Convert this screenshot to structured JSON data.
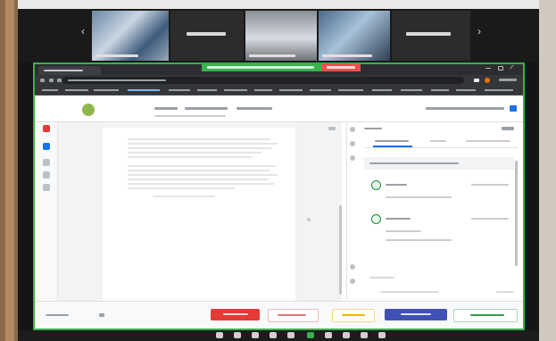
{
  "meeting": {
    "strip_nav_left": "‹",
    "strip_nav_right": "›",
    "participants": [
      {
        "name": "",
        "video": true
      },
      {
        "name": "",
        "video": false
      },
      {
        "name": "",
        "video": true
      },
      {
        "name": "",
        "video": true
      },
      {
        "name": "",
        "video": false
      }
    ],
    "share_banner": "",
    "stop_share": ""
  },
  "browser": {
    "tab_title": "",
    "url": ""
  },
  "docs": {
    "title": "",
    "tabs": [
      "",
      "",
      ""
    ]
  },
  "comments_panel": {
    "tabs": [
      "",
      "",
      ""
    ],
    "comments": [
      {
        "author": "",
        "time": ""
      },
      {
        "author": "",
        "time": ""
      }
    ]
  },
  "action_bar": {
    "buttons": [
      "",
      "",
      "",
      "",
      ""
    ]
  },
  "colors": {
    "share_green": "#37b24d",
    "stop_red": "#e9504c",
    "docs_blue": "#1a73e8",
    "avatar_green": "#8fb64a"
  }
}
